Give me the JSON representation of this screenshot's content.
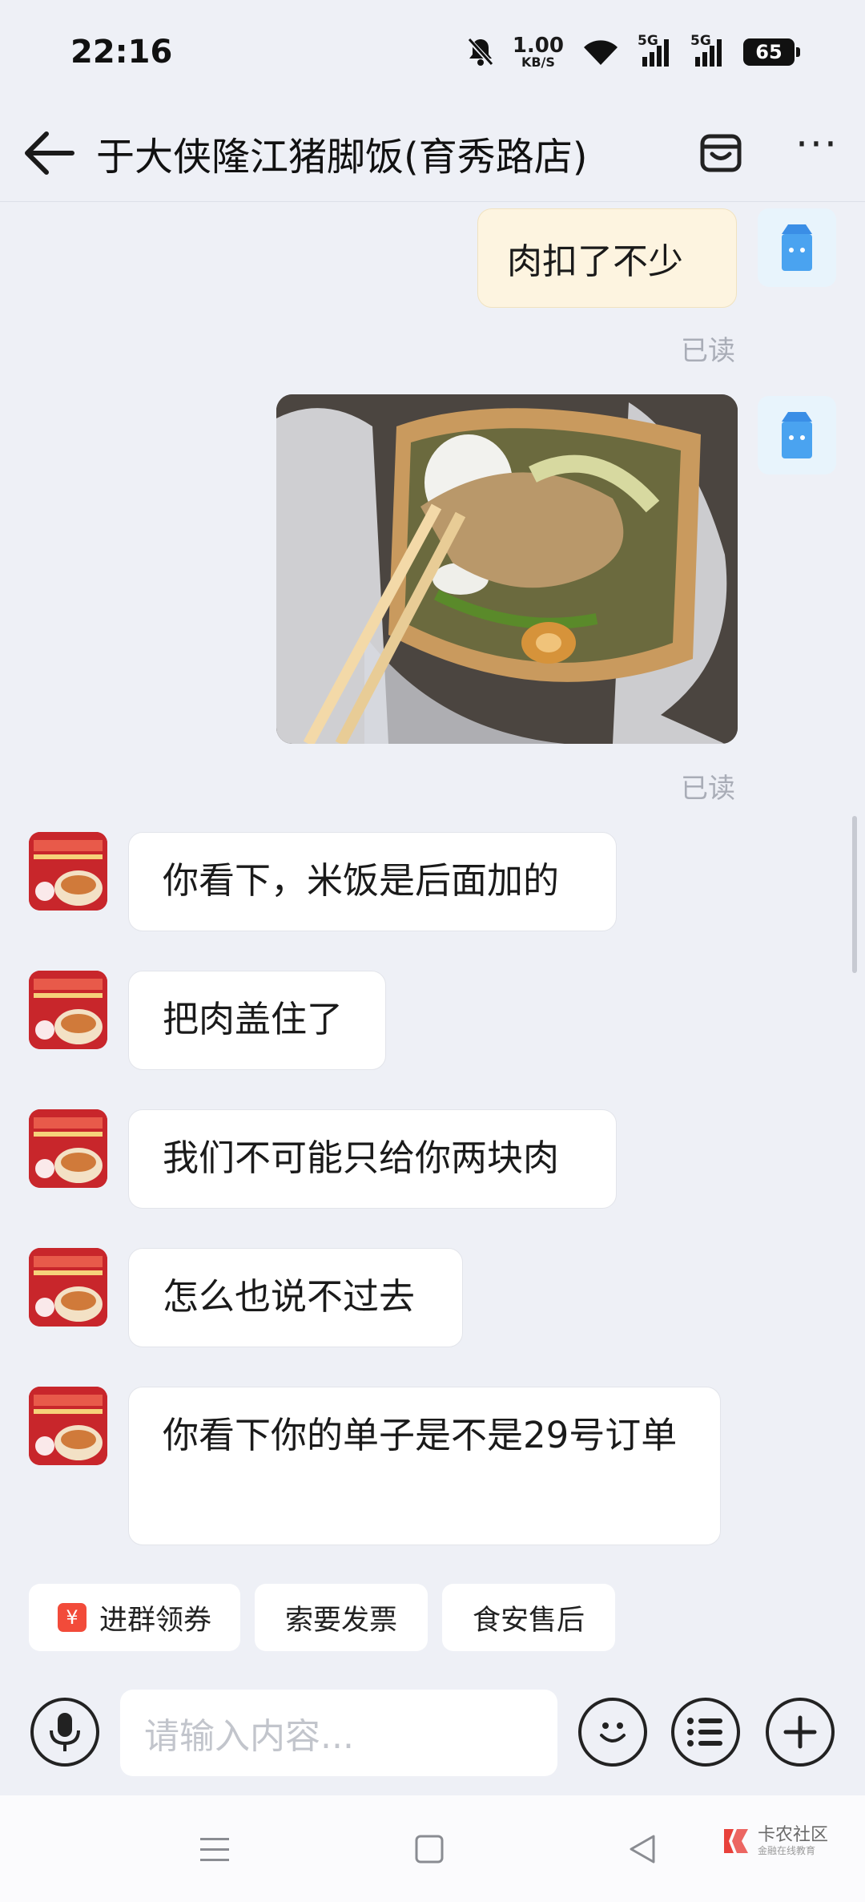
{
  "status_bar": {
    "time": "22:16",
    "speed_value": "1.00",
    "speed_unit": "KB/S",
    "sim1": "5G",
    "sim2": "5G",
    "battery": "65"
  },
  "header": {
    "title": "于大侠隆江猪脚饭(育秀路店)",
    "icons": [
      "back-arrow-icon",
      "store-icon",
      "more-icon"
    ]
  },
  "chat": {
    "outgoing": [
      {
        "type": "text",
        "text": "肉扣了不少",
        "status": "已读"
      },
      {
        "type": "image",
        "status": "已读"
      }
    ],
    "incoming": [
      {
        "text": "你看下，米饭是后面加的"
      },
      {
        "text": "把肉盖住了"
      },
      {
        "text": "我们不可能只给你两块肉"
      },
      {
        "text": "怎么也说不过去"
      },
      {
        "text": "你看下你的单子是不是29号订单"
      }
    ]
  },
  "quick_actions": [
    {
      "label": "进群领券",
      "icon": "coupon-icon",
      "icon_char": "¥"
    },
    {
      "label": "索要发票"
    },
    {
      "label": "食安售后"
    }
  ],
  "input": {
    "placeholder": "请输入内容..."
  },
  "watermark": {
    "main": "卡农社区",
    "sub": "金融在线教育"
  },
  "colors": {
    "background": "#eef0f6",
    "outgoing_bubble": "#fdf4e0",
    "incoming_bubble": "#ffffff",
    "shop_avatar": "#c8262b",
    "coupon_icon": "#f24b3a"
  }
}
